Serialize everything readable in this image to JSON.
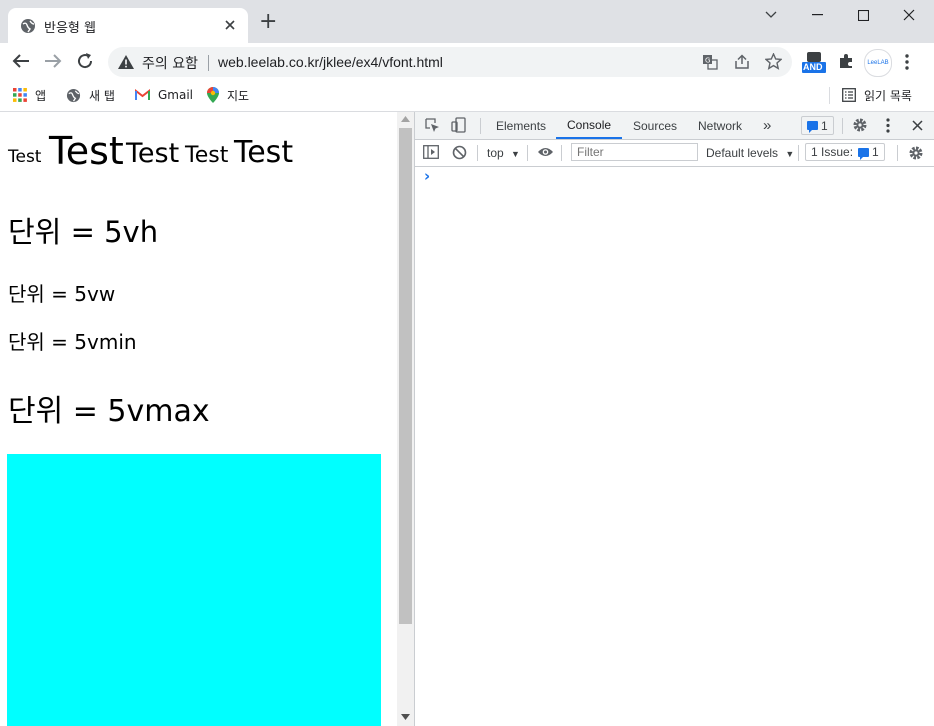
{
  "browser": {
    "tab": {
      "title": "반응형 웹"
    },
    "new_tab_symbol": "+",
    "address": {
      "security_label": "주의 요함",
      "url": "web.leelab.co.kr/jklee/ex4/vfont.html"
    },
    "extensions": {
      "and_badge": "AND",
      "leelab_label": "LeeLAB"
    },
    "bookmarks": [
      {
        "label": "앱",
        "icon": "apps-grid-icon"
      },
      {
        "label": "새 탭",
        "icon": "globe-icon"
      },
      {
        "label": "Gmail",
        "icon": "gmail-icon"
      },
      {
        "label": "지도",
        "icon": "maps-pin-icon"
      }
    ],
    "reading_list": "읽기 목록"
  },
  "page": {
    "test_words": [
      "Test",
      "Test",
      "Test",
      "Test",
      "Test"
    ],
    "lines": [
      "단위 = 5vh",
      "단위 = 5vw",
      "단위 = 5vmin",
      "단위 = 5vmax"
    ],
    "box_color": "#00ffff"
  },
  "devtools": {
    "tabs": [
      "Elements",
      "Console",
      "Sources",
      "Network"
    ],
    "active_tab": "Console",
    "more_tabs": "»",
    "issues_count": "1",
    "context": "top",
    "filter_placeholder": "Filter",
    "levels": "Default levels",
    "issues_label": "1 Issue:",
    "issues_badge_count": "1",
    "prompt": "›"
  },
  "colors": {
    "accent": "#1a73e8",
    "tabstrip": "#dfe1e5",
    "omnibox": "#f1f3f4"
  }
}
